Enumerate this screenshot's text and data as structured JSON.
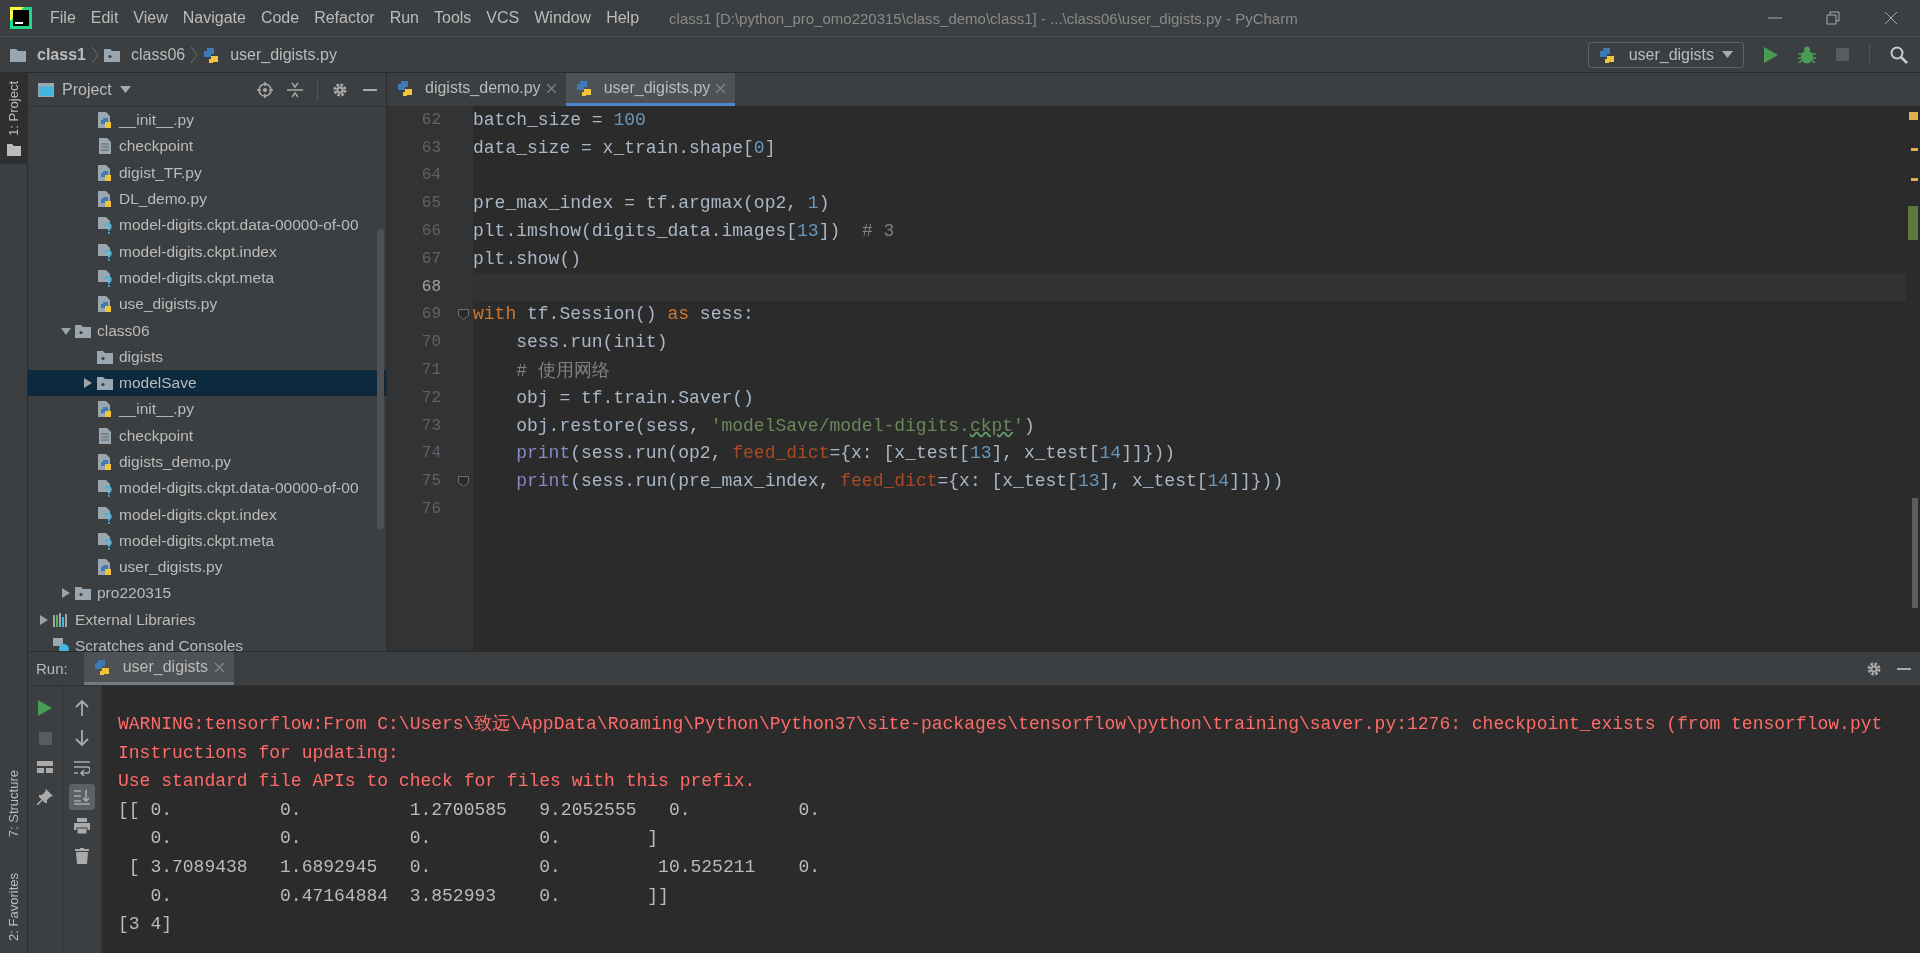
{
  "title_bar": {
    "menu": [
      "File",
      "Edit",
      "View",
      "Navigate",
      "Code",
      "Refactor",
      "Run",
      "Tools",
      "VCS",
      "Window",
      "Help"
    ],
    "title": "class1 [D:\\python_pro_omo220315\\class_demo\\class1] - ...\\class06\\user_digists.py - PyCharm"
  },
  "breadcrumb": [
    {
      "label": "class1",
      "kind": "project"
    },
    {
      "label": "class06",
      "kind": "folder"
    },
    {
      "label": "user_digists.py",
      "kind": "python"
    }
  ],
  "run_config": {
    "label": "user_digists"
  },
  "left_stripe": {
    "top": [
      {
        "label": "1: Project",
        "selected": true
      }
    ],
    "bottom": [
      {
        "label": "7: Structure",
        "selected": false
      },
      {
        "label": "2: Favorites",
        "selected": false
      }
    ]
  },
  "project_panel": {
    "title": "Project",
    "tree": [
      {
        "children": [
          {
            "children": [
              {
                "label": "__init__.py",
                "kind": "python",
                "selected": false
              },
              {
                "label": "checkpoint",
                "kind": "text",
                "selected": false
              },
              {
                "label": "digist_TF.py",
                "kind": "python",
                "selected": false
              },
              {
                "label": "DL_demo.py",
                "kind": "python",
                "selected": false
              },
              {
                "label": "model-digits.ckpt.data-00000-of-00",
                "kind": "unknown",
                "selected": false
              },
              {
                "label": "model-digits.ckpt.index",
                "kind": "unknown",
                "selected": false
              },
              {
                "label": "model-digits.ckpt.meta",
                "kind": "unknown",
                "selected": false
              },
              {
                "label": "use_digists.py",
                "kind": "python",
                "selected": false
              }
            ]
          },
          {
            "label": "class06",
            "kind": "folder",
            "expanded": true,
            "selected": false,
            "children": [
              {
                "label": "digists",
                "kind": "folder",
                "selected": false
              },
              {
                "label": "modelSave",
                "kind": "folder",
                "expanded": false,
                "selected": true
              },
              {
                "label": "__init__.py",
                "kind": "python",
                "selected": false
              },
              {
                "label": "checkpoint",
                "kind": "text",
                "selected": false
              },
              {
                "label": "digists_demo.py",
                "kind": "python",
                "selected": false
              },
              {
                "label": "model-digits.ckpt.data-00000-of-00",
                "kind": "unknown",
                "selected": false
              },
              {
                "label": "model-digits.ckpt.index",
                "kind": "unknown",
                "selected": false
              },
              {
                "label": "model-digits.ckpt.meta",
                "kind": "unknown",
                "selected": false
              },
              {
                "label": "user_digists.py",
                "kind": "python",
                "selected": false
              }
            ]
          },
          {
            "label": "pro220315",
            "kind": "folder",
            "expanded": false,
            "selected": false
          }
        ]
      },
      {
        "label": "External Libraries",
        "kind": "library",
        "expanded": false,
        "selected": false
      },
      {
        "label": "Scratches and Consoles",
        "kind": "scratches",
        "selected": false
      }
    ]
  },
  "editor": {
    "tabs": [
      {
        "label": "digists_demo.py",
        "selected": false
      },
      {
        "label": "user_digists.py",
        "selected": true
      }
    ],
    "lines": [
      {
        "number": "62",
        "caret": false,
        "fold_marker": false,
        "tokens": [
          {
            "text": "batch_size = ",
            "kind": "plain"
          },
          {
            "text": "100",
            "kind": "number"
          }
        ]
      },
      {
        "number": "63",
        "caret": false,
        "fold_marker": false,
        "tokens": [
          {
            "text": "data_size = x_train.shape[",
            "kind": "plain"
          },
          {
            "text": "0",
            "kind": "number"
          },
          {
            "text": "]",
            "kind": "plain"
          }
        ]
      },
      {
        "number": "64",
        "caret": false,
        "fold_marker": false
      },
      {
        "number": "65",
        "caret": false,
        "fold_marker": false,
        "tokens": [
          {
            "text": "pre_max_index = tf.argmax(op2, ",
            "kind": "plain"
          },
          {
            "text": "1",
            "kind": "number"
          },
          {
            "text": ")",
            "kind": "plain"
          }
        ]
      },
      {
        "number": "66",
        "caret": false,
        "fold_marker": false,
        "tokens": [
          {
            "text": "plt.imshow(digits_data.images[",
            "kind": "plain"
          },
          {
            "text": "13",
            "kind": "number"
          },
          {
            "text": "])  ",
            "kind": "plain"
          },
          {
            "text": "# 3",
            "kind": "comment"
          }
        ]
      },
      {
        "number": "67",
        "caret": false,
        "fold_marker": false,
        "tokens": [
          {
            "text": "plt.show()",
            "kind": "plain"
          }
        ]
      },
      {
        "number": "68",
        "caret": true,
        "fold_marker": false
      },
      {
        "number": "69",
        "caret": false,
        "fold_marker": true,
        "tokens": [
          {
            "text": "with",
            "kind": "keyword"
          },
          {
            "text": " tf.Session() ",
            "kind": "plain"
          },
          {
            "text": "as",
            "kind": "keyword"
          },
          {
            "text": " sess:",
            "kind": "plain"
          }
        ]
      },
      {
        "number": "70",
        "caret": false,
        "fold_marker": false,
        "tokens": [
          {
            "text": "    sess.run(init)",
            "kind": "plain"
          }
        ]
      },
      {
        "number": "71",
        "caret": false,
        "fold_marker": false,
        "tokens": [
          {
            "text": "    # 使用网络",
            "kind": "comment"
          }
        ]
      },
      {
        "number": "72",
        "caret": false,
        "fold_marker": false,
        "tokens": [
          {
            "text": "    obj = tf.train.Saver()",
            "kind": "plain"
          }
        ]
      },
      {
        "number": "73",
        "caret": false,
        "fold_marker": false,
        "tokens": [
          {
            "text": "    obj.restore(sess, ",
            "kind": "plain"
          },
          {
            "text": "'modelSave/model-digits.",
            "kind": "string"
          },
          {
            "text": "ckpt",
            "kind": "typo"
          },
          {
            "text": "'",
            "kind": "string"
          },
          {
            "text": ")",
            "kind": "plain"
          }
        ]
      },
      {
        "number": "74",
        "caret": false,
        "fold_marker": false,
        "tokens": [
          {
            "text": "    print",
            "kind": "builtin"
          },
          {
            "text": "(sess.run(op2, ",
            "kind": "plain"
          },
          {
            "text": "feed_dict",
            "kind": "param"
          },
          {
            "text": "={x: [x_test[",
            "kind": "plain"
          },
          {
            "text": "13",
            "kind": "number"
          },
          {
            "text": "], x_test[",
            "kind": "plain"
          },
          {
            "text": "14",
            "kind": "number"
          },
          {
            "text": "]]}))",
            "kind": "plain"
          }
        ]
      },
      {
        "number": "75",
        "caret": false,
        "fold_marker": true,
        "tokens": [
          {
            "text": "    print",
            "kind": "builtin"
          },
          {
            "text": "(sess.run(pre_max_index, ",
            "kind": "plain"
          },
          {
            "text": "feed_dict",
            "kind": "param"
          },
          {
            "text": "={x: [x_test[",
            "kind": "plain"
          },
          {
            "text": "13",
            "kind": "number"
          },
          {
            "text": "], x_test[",
            "kind": "plain"
          },
          {
            "text": "14",
            "kind": "number"
          },
          {
            "text": "]]}))",
            "kind": "plain"
          }
        ]
      },
      {
        "number": "76",
        "caret": false,
        "fold_marker": false
      }
    ]
  },
  "run_panel": {
    "label": "Run:",
    "tabs": [
      {
        "label": "user_digists",
        "selected": true
      }
    ],
    "autoscroll": true,
    "output": [
      {
        "kind": "error",
        "text": "WARNING:tensorflow:From C:\\Users\\致远\\AppData\\Roaming\\Python\\Python37\\site-packages\\tensorflow\\python\\training\\saver.py:1276: checkpoint_exists (from tensorflow.pyt"
      },
      {
        "kind": "error",
        "text": "Instructions for updating:"
      },
      {
        "kind": "error",
        "text": "Use standard file APIs to check for files with this prefix."
      },
      {
        "kind": "plain",
        "text": "[[ 0.          0.          1.2700585   9.2052555   0.          0.\n   0.          0.          0.          0.        ]"
      },
      {
        "kind": "plain",
        "text": " [ 3.7089438   1.6892945   0.          0.         10.525211    0.\n   0.          0.47164884  3.852993    0.        ]]"
      },
      {
        "kind": "plain",
        "text": "[3 4]"
      }
    ]
  }
}
